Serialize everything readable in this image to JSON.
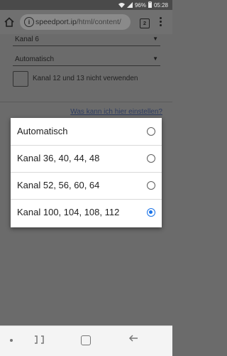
{
  "status_bar": {
    "battery": "96%",
    "time": "05:28"
  },
  "browser": {
    "url_host": "speedport.ip",
    "url_path": "/html/content/",
    "tab_count": "2"
  },
  "form": {
    "select_channel_value": "Kanal 6",
    "select_mode_value": "Automatisch",
    "checkbox_label": "Kanal 12 und 13 nicht verwenden",
    "help_link": "Was kann ich hier einstellen?"
  },
  "dialog": {
    "options": [
      {
        "label": "Automatisch",
        "selected": false
      },
      {
        "label": "Kanal 36, 40, 44, 48",
        "selected": false
      },
      {
        "label": "Kanal 52, 56, 60, 64",
        "selected": false
      },
      {
        "label": "Kanal 100, 104, 108, 112",
        "selected": true
      }
    ]
  },
  "colors": {
    "accent": "#1a73e8"
  }
}
